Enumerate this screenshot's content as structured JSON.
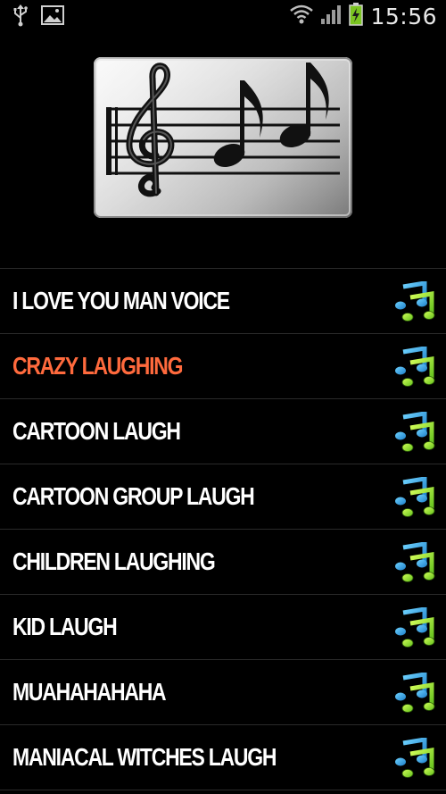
{
  "status_bar": {
    "time": "15:56",
    "icons": [
      "usb-icon",
      "image-icon",
      "wifi-icon",
      "signal-icon",
      "battery-charging-icon"
    ]
  },
  "header": {
    "image": "music-staff-art"
  },
  "sounds": [
    {
      "label": "I LOVE YOU MAN VOICE",
      "icon": "music-notes-icon",
      "active": false
    },
    {
      "label": "CRAZY LAUGHING",
      "icon": "music-notes-icon",
      "active": true
    },
    {
      "label": "CARTOON LAUGH",
      "icon": "music-notes-icon",
      "active": false
    },
    {
      "label": "CARTOON GROUP LAUGH",
      "icon": "music-notes-icon",
      "active": false
    },
    {
      "label": "CHILDREN LAUGHING",
      "icon": "music-notes-icon",
      "active": false
    },
    {
      "label": "KID LAUGH",
      "icon": "music-notes-icon",
      "active": false
    },
    {
      "label": "MUAHAHAHAHA",
      "icon": "music-notes-icon",
      "active": false
    },
    {
      "label": "MANIACAL WITCHES LAUGH",
      "icon": "music-notes-icon",
      "active": false
    }
  ],
  "colors": {
    "active_label": "#ff6a3d",
    "label": "#ffffff",
    "background": "#000000"
  }
}
